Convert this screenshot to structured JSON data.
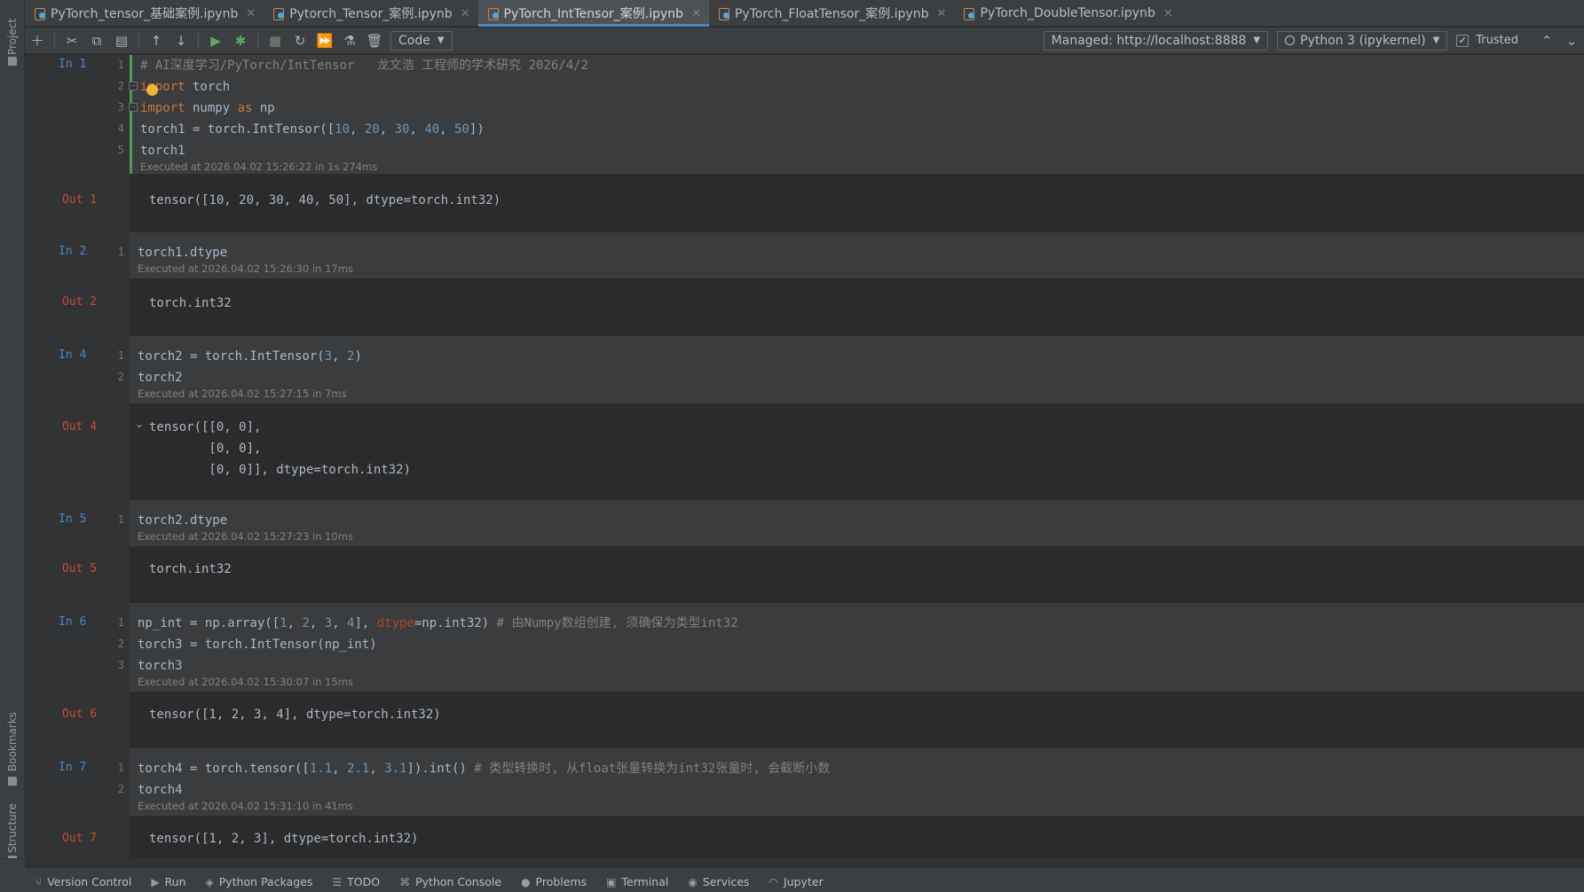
{
  "side_tabs": {
    "project": "Project",
    "bookmarks": "Bookmarks",
    "structure": "Structure"
  },
  "tabs": [
    {
      "label": "PyTorch_tensor_基础案例.ipynb",
      "active": false
    },
    {
      "label": "Pytorch_Tensor_案例.ipynb",
      "active": false
    },
    {
      "label": "PyTorch_IntTensor_案例.ipynb",
      "active": true
    },
    {
      "label": "PyTorch_FloatTensor_案例.ipynb",
      "active": false
    },
    {
      "label": "PyTorch_DoubleTensor.ipynb",
      "active": false
    }
  ],
  "toolbar": {
    "cell_type": "Code",
    "server": "Managed: http://localhost:8888",
    "kernel": "Python 3 (ipykernel)",
    "trusted_label": "Trusted"
  },
  "inspections": {
    "warnings": "1",
    "ok": "1"
  },
  "cells": [
    {
      "in_label": "In 1",
      "exec": "Executed at 2026.04.02 15:26:22 in 1s 274ms",
      "out_label": "Out 1",
      "output": [
        "tensor([10, 20, 30, 40, 50], dtype=torch.int32)"
      ]
    },
    {
      "in_label": "In 2",
      "exec": "Executed at 2026.04.02 15:26:30 in 17ms",
      "out_label": "Out 2",
      "output": [
        "torch.int32"
      ]
    },
    {
      "in_label": "In 4",
      "exec": "Executed at 2026.04.02 15:27:15 in 7ms",
      "out_label": "Out 4",
      "output": [
        "tensor([[0, 0],",
        "        [0, 0],",
        "        [0, 0]], dtype=torch.int32)"
      ]
    },
    {
      "in_label": "In 5",
      "exec": "Executed at 2026.04.02 15:27:23 in 10ms",
      "out_label": "Out 5",
      "output": [
        "torch.int32"
      ]
    },
    {
      "in_label": "In 6",
      "exec": "Executed at 2026.04.02 15:30:07 in 15ms",
      "out_label": "Out 6",
      "output": [
        "tensor([1, 2, 3, 4], dtype=torch.int32)"
      ]
    },
    {
      "in_label": "In 7",
      "exec": "Executed at 2026.04.02 15:31:10 in 41ms",
      "out_label": "Out 7",
      "output": [
        "tensor([1, 2, 3], dtype=torch.int32)"
      ]
    }
  ],
  "code": {
    "c1_l1": "# AI深度学习/PyTorch/IntTensor   龙文浩 工程师的学术研究 2026/4/2",
    "c1_l2a": "import",
    "c1_l2b": " torch",
    "c1_l3a": "import",
    "c1_l3b": " numpy ",
    "c1_l3c": "as",
    "c1_l3d": " np",
    "c1_l4a": "torch1 = torch.IntTensor([",
    "c1_n1": "10",
    "c1_n2": "20",
    "c1_n3": "30",
    "c1_n4": "40",
    "c1_n5": "50",
    "c1_l4b": "])",
    "c1_l5": "torch1",
    "c2_l1": "torch1.dtype",
    "c3_l1a": "torch2 = torch.IntTensor(",
    "c3_n1": "3",
    "c3_n2": "2",
    "c3_l1b": ")",
    "c3_l2": "torch2",
    "c4_l1": "torch2.dtype",
    "c5_l1a": "np_int = np.array([",
    "c5_n1": "1",
    "c5_n2": "2",
    "c5_n3": "3",
    "c5_n4": "4",
    "c5_l1b": "], ",
    "c5_p": "dtype",
    "c5_l1c": "=np.int32) ",
    "c5_cmt": "# 由Numpy数组创建, 须确保为类型int32",
    "c5_l2": "torch3 = torch.IntTensor(np_int)",
    "c5_l3": "torch3",
    "c6_l1a": "torch4 = torch.tensor([",
    "c6_n1": "1.1",
    "c6_n2": "2.1",
    "c6_n3": "3.1",
    "c6_l1b": "]).int() ",
    "c6_cmt": "# 类型转换时, 从float张量转换为int32张量时, 会截断小数",
    "c6_l2": "torch4"
  },
  "bottom_tabs": [
    "Version Control",
    "Run",
    "Python Packages",
    "TODO",
    "Python Console",
    "Problems",
    "Terminal",
    "Services",
    "Jupyter"
  ]
}
